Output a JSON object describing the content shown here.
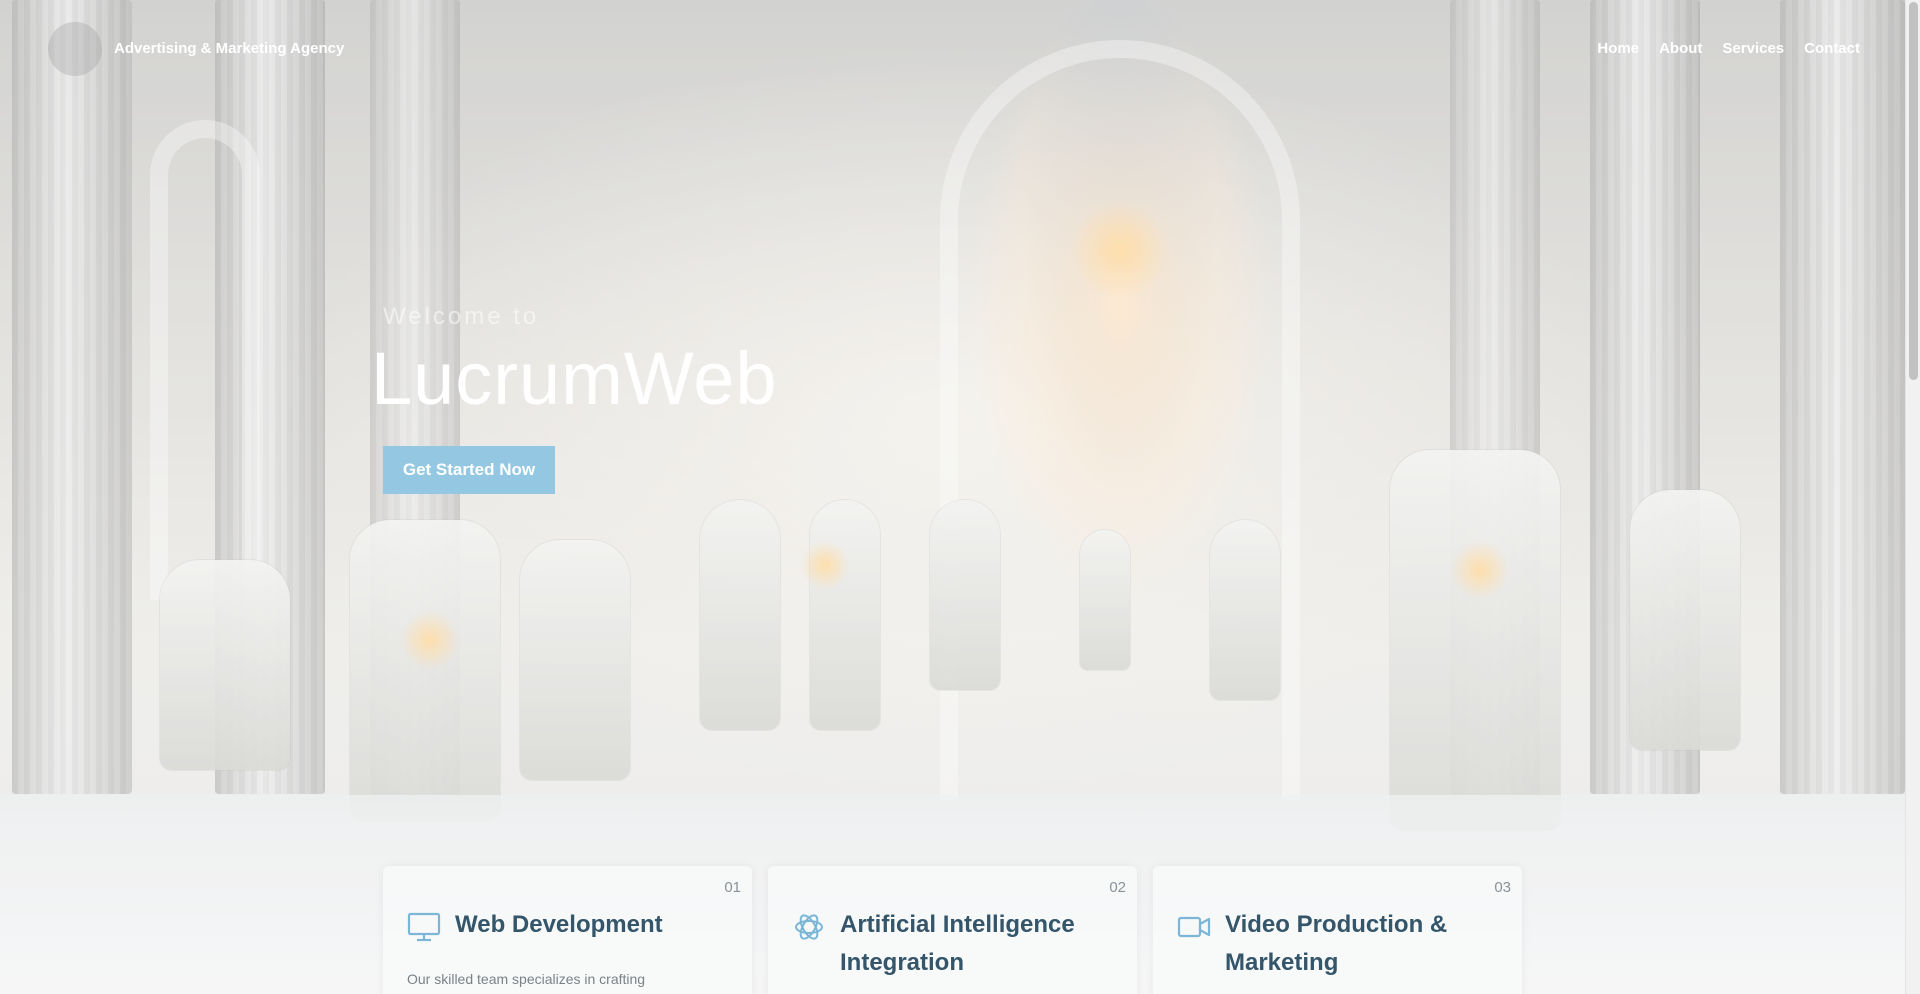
{
  "navbar": {
    "brand": "Advertising & Marketing Agency",
    "links": [
      "Home",
      "About",
      "Services",
      "Contact"
    ]
  },
  "hero": {
    "welcome": "Welcome to",
    "title": "LucrumWeb",
    "cta_label": "Get Started Now"
  },
  "services": [
    {
      "number": "01",
      "title": "Web Development",
      "icon": "monitor-icon",
      "text": "Our skilled team specializes in crafting"
    },
    {
      "number": "02",
      "title": "Artificial Intelligence Integration",
      "icon": "ai-knot-icon",
      "text": ""
    },
    {
      "number": "03",
      "title": "Video Production & Marketing",
      "icon": "video-camera-icon",
      "text": ""
    }
  ],
  "colors": {
    "accent": "#94c8e2",
    "card_title": "#34556a",
    "icon": "#7bb6d6"
  }
}
